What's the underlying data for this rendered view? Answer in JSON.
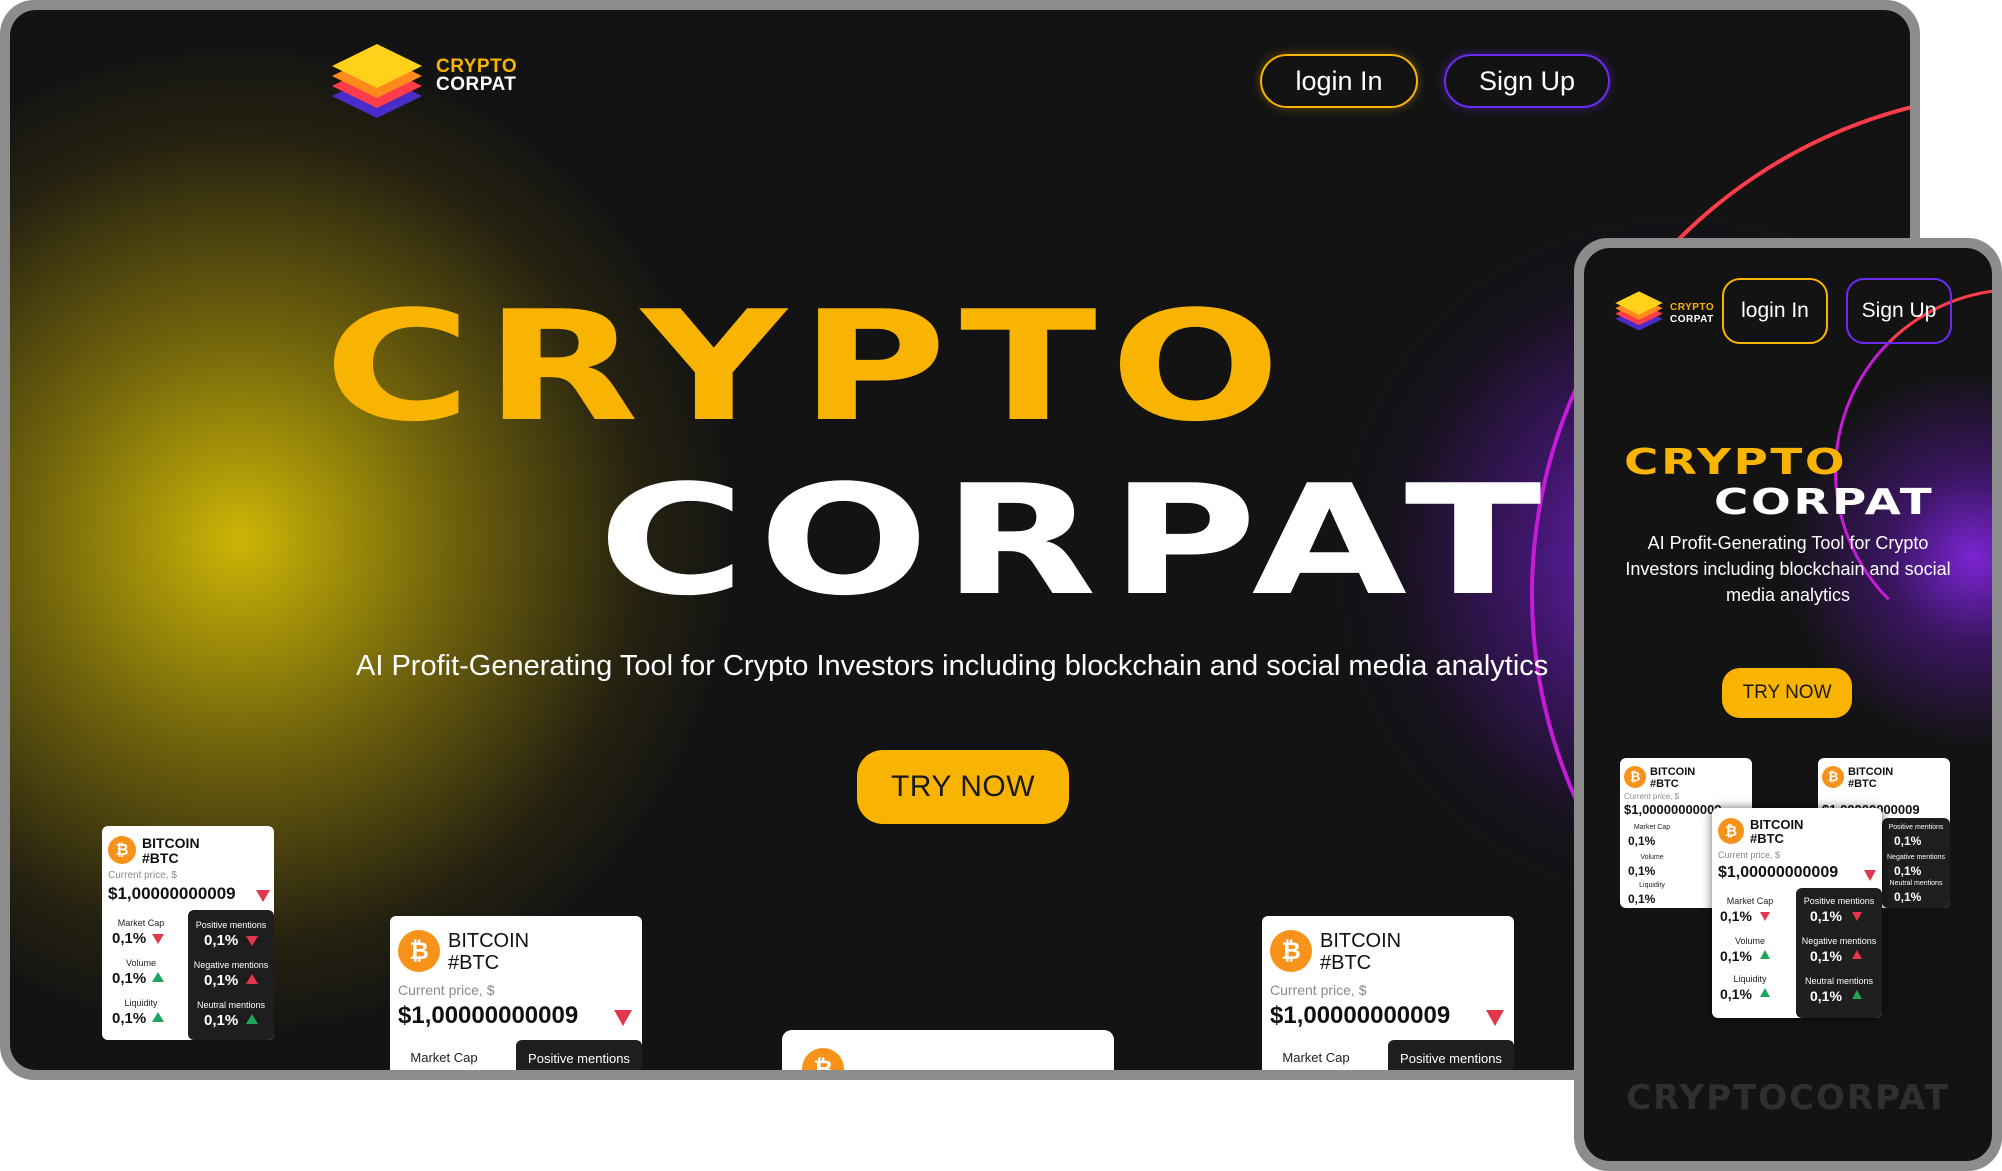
{
  "brand": {
    "line1": "CRYPTO",
    "line2": "CORPAT",
    "primary_color": "#f8b400",
    "secondary_color": "#6a2cf2",
    "background": "#131313"
  },
  "nav": {
    "login_label": "login In",
    "signup_label": "Sign Up"
  },
  "hero": {
    "title_line1": "CRYPTO",
    "title_line2": "CORPAT",
    "tagline": "AI Profit-Generating Tool for Crypto Investors including blockchain and social media analytics",
    "cta_label": "TRY NOW"
  },
  "card": {
    "coin_symbol": "₿",
    "coin_name": "BITCOIN",
    "ticker": "#BTC",
    "price_label": "Current price, $",
    "price": "$1,00000000009",
    "market_cap_label": "Market Cap",
    "market_cap": "0,1%",
    "volume_label": "Volume",
    "volume": "0,1%",
    "liquidity_label": "Liquidity",
    "liquidity": "0,1%",
    "positive_label": "Positive mentions",
    "positive": "0,1%",
    "negative_label": "Negative mentions",
    "negative": "0,1%",
    "neutral_label": "Neutral mentions",
    "neutral": "0,1%"
  },
  "mobile": {
    "login_label": "login In",
    "signup_label": "Sign Up",
    "title_line1": "CRYPTO",
    "title_line2": "CORPAT",
    "tagline": "AI Profit-Generating Tool for Crypto Investors including blockchain and social media analytics",
    "cta_label": "TRY NOW",
    "watermark": "CRYPTOCORPAT"
  },
  "icons": {
    "logo": "stacked-layers-icon",
    "coin": "bitcoin-icon",
    "down": "triangle-down-icon",
    "up": "triangle-up-icon"
  }
}
